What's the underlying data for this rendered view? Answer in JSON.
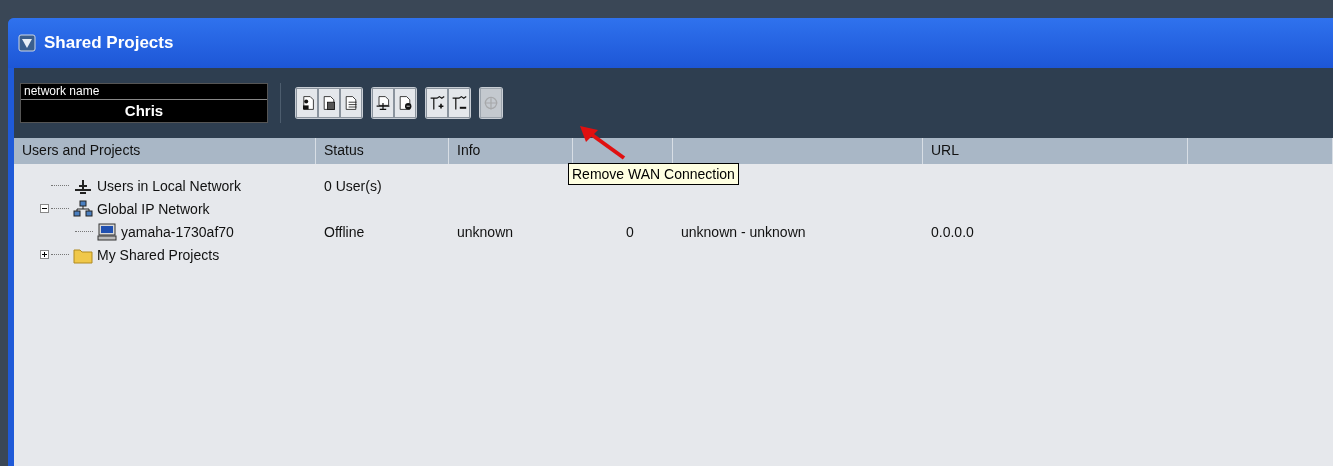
{
  "window": {
    "title": "Shared Projects"
  },
  "network_name": {
    "label": "network name",
    "value": "Chris"
  },
  "toolbar": [
    {
      "group": [
        {
          "kind": "user",
          "disabled": false
        },
        {
          "kind": "copy",
          "disabled": false
        },
        {
          "kind": "list",
          "disabled": false
        }
      ]
    },
    {
      "group": [
        {
          "kind": "share",
          "disabled": false
        },
        {
          "kind": "remove",
          "disabled": false
        }
      ]
    },
    {
      "group": [
        {
          "kind": "wan-add",
          "disabled": false
        },
        {
          "kind": "wan-remove",
          "disabled": false
        }
      ]
    },
    {
      "group": [
        {
          "kind": "connect",
          "disabled": true
        }
      ]
    }
  ],
  "tooltip": {
    "text": "Remove WAN Connection"
  },
  "table": {
    "columns": [
      "Users and Projects",
      "Status",
      "Info",
      null,
      null,
      "URL",
      null
    ],
    "rows": [
      {
        "label": "Users in Local Network",
        "kind": "network",
        "status": "0 User(s)"
      },
      {
        "label": "Global IP Network",
        "kind": "hub",
        "expanded": true,
        "children": [
          {
            "label": "yamaha-1730af70",
            "kind": "computer",
            "status": "Offline",
            "info": "unknown",
            "column_4": "0",
            "column_5": "unknown - unknown",
            "url": "0.0.0.0"
          }
        ]
      },
      {
        "label": "My Shared Projects",
        "kind": "folder",
        "expanded": false
      }
    ]
  }
}
